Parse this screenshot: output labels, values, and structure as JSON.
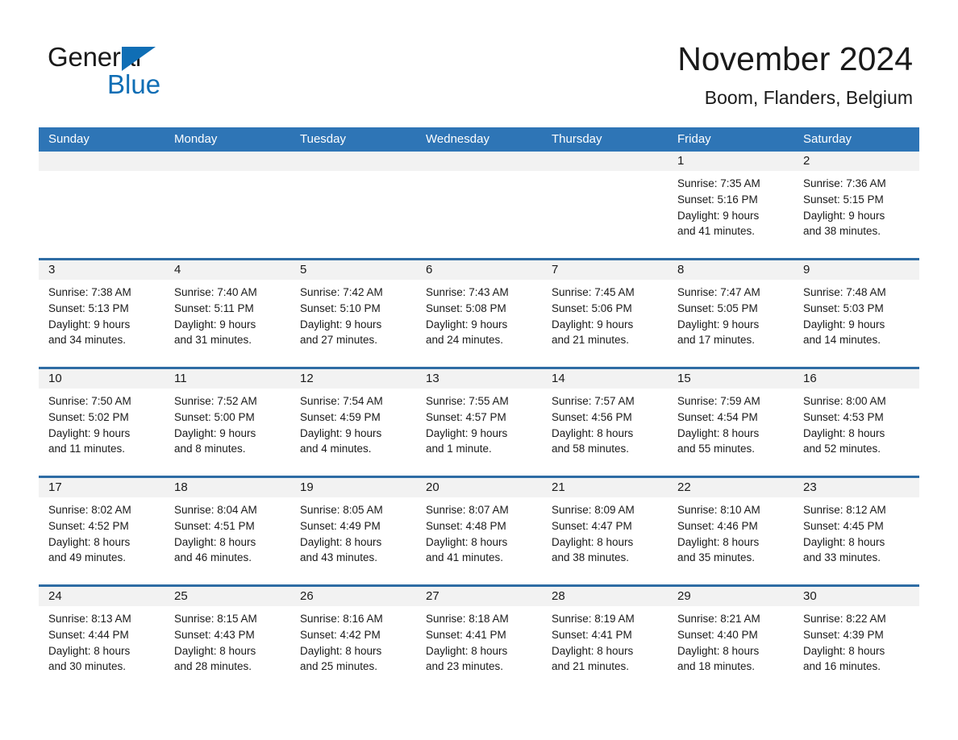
{
  "brand": {
    "name_part1": "General",
    "name_part2": "Blue",
    "triangle_color": "#0f6eb5",
    "text_color": "#1a1a1a"
  },
  "header": {
    "title": "November 2024",
    "subtitle": "Boom, Flanders, Belgium"
  },
  "theme": {
    "header_blue": "#2e75b6",
    "row_divider_blue": "#2e6ca4",
    "day_band_gray": "#f2f2f2",
    "page_background": "#ffffff",
    "text": "#1a1a1a"
  },
  "weekday_headers": [
    "Sunday",
    "Monday",
    "Tuesday",
    "Wednesday",
    "Thursday",
    "Friday",
    "Saturday"
  ],
  "weeks": [
    [
      {
        "day": "",
        "sunrise": "",
        "sunset": "",
        "daylight_line1": "",
        "daylight_line2": ""
      },
      {
        "day": "",
        "sunrise": "",
        "sunset": "",
        "daylight_line1": "",
        "daylight_line2": ""
      },
      {
        "day": "",
        "sunrise": "",
        "sunset": "",
        "daylight_line1": "",
        "daylight_line2": ""
      },
      {
        "day": "",
        "sunrise": "",
        "sunset": "",
        "daylight_line1": "",
        "daylight_line2": ""
      },
      {
        "day": "",
        "sunrise": "",
        "sunset": "",
        "daylight_line1": "",
        "daylight_line2": ""
      },
      {
        "day": "1",
        "sunrise": "Sunrise: 7:35 AM",
        "sunset": "Sunset: 5:16 PM",
        "daylight_line1": "Daylight: 9 hours",
        "daylight_line2": "and 41 minutes."
      },
      {
        "day": "2",
        "sunrise": "Sunrise: 7:36 AM",
        "sunset": "Sunset: 5:15 PM",
        "daylight_line1": "Daylight: 9 hours",
        "daylight_line2": "and 38 minutes."
      }
    ],
    [
      {
        "day": "3",
        "sunrise": "Sunrise: 7:38 AM",
        "sunset": "Sunset: 5:13 PM",
        "daylight_line1": "Daylight: 9 hours",
        "daylight_line2": "and 34 minutes."
      },
      {
        "day": "4",
        "sunrise": "Sunrise: 7:40 AM",
        "sunset": "Sunset: 5:11 PM",
        "daylight_line1": "Daylight: 9 hours",
        "daylight_line2": "and 31 minutes."
      },
      {
        "day": "5",
        "sunrise": "Sunrise: 7:42 AM",
        "sunset": "Sunset: 5:10 PM",
        "daylight_line1": "Daylight: 9 hours",
        "daylight_line2": "and 27 minutes."
      },
      {
        "day": "6",
        "sunrise": "Sunrise: 7:43 AM",
        "sunset": "Sunset: 5:08 PM",
        "daylight_line1": "Daylight: 9 hours",
        "daylight_line2": "and 24 minutes."
      },
      {
        "day": "7",
        "sunrise": "Sunrise: 7:45 AM",
        "sunset": "Sunset: 5:06 PM",
        "daylight_line1": "Daylight: 9 hours",
        "daylight_line2": "and 21 minutes."
      },
      {
        "day": "8",
        "sunrise": "Sunrise: 7:47 AM",
        "sunset": "Sunset: 5:05 PM",
        "daylight_line1": "Daylight: 9 hours",
        "daylight_line2": "and 17 minutes."
      },
      {
        "day": "9",
        "sunrise": "Sunrise: 7:48 AM",
        "sunset": "Sunset: 5:03 PM",
        "daylight_line1": "Daylight: 9 hours",
        "daylight_line2": "and 14 minutes."
      }
    ],
    [
      {
        "day": "10",
        "sunrise": "Sunrise: 7:50 AM",
        "sunset": "Sunset: 5:02 PM",
        "daylight_line1": "Daylight: 9 hours",
        "daylight_line2": "and 11 minutes."
      },
      {
        "day": "11",
        "sunrise": "Sunrise: 7:52 AM",
        "sunset": "Sunset: 5:00 PM",
        "daylight_line1": "Daylight: 9 hours",
        "daylight_line2": "and 8 minutes."
      },
      {
        "day": "12",
        "sunrise": "Sunrise: 7:54 AM",
        "sunset": "Sunset: 4:59 PM",
        "daylight_line1": "Daylight: 9 hours",
        "daylight_line2": "and 4 minutes."
      },
      {
        "day": "13",
        "sunrise": "Sunrise: 7:55 AM",
        "sunset": "Sunset: 4:57 PM",
        "daylight_line1": "Daylight: 9 hours",
        "daylight_line2": "and 1 minute."
      },
      {
        "day": "14",
        "sunrise": "Sunrise: 7:57 AM",
        "sunset": "Sunset: 4:56 PM",
        "daylight_line1": "Daylight: 8 hours",
        "daylight_line2": "and 58 minutes."
      },
      {
        "day": "15",
        "sunrise": "Sunrise: 7:59 AM",
        "sunset": "Sunset: 4:54 PM",
        "daylight_line1": "Daylight: 8 hours",
        "daylight_line2": "and 55 minutes."
      },
      {
        "day": "16",
        "sunrise": "Sunrise: 8:00 AM",
        "sunset": "Sunset: 4:53 PM",
        "daylight_line1": "Daylight: 8 hours",
        "daylight_line2": "and 52 minutes."
      }
    ],
    [
      {
        "day": "17",
        "sunrise": "Sunrise: 8:02 AM",
        "sunset": "Sunset: 4:52 PM",
        "daylight_line1": "Daylight: 8 hours",
        "daylight_line2": "and 49 minutes."
      },
      {
        "day": "18",
        "sunrise": "Sunrise: 8:04 AM",
        "sunset": "Sunset: 4:51 PM",
        "daylight_line1": "Daylight: 8 hours",
        "daylight_line2": "and 46 minutes."
      },
      {
        "day": "19",
        "sunrise": "Sunrise: 8:05 AM",
        "sunset": "Sunset: 4:49 PM",
        "daylight_line1": "Daylight: 8 hours",
        "daylight_line2": "and 43 minutes."
      },
      {
        "day": "20",
        "sunrise": "Sunrise: 8:07 AM",
        "sunset": "Sunset: 4:48 PM",
        "daylight_line1": "Daylight: 8 hours",
        "daylight_line2": "and 41 minutes."
      },
      {
        "day": "21",
        "sunrise": "Sunrise: 8:09 AM",
        "sunset": "Sunset: 4:47 PM",
        "daylight_line1": "Daylight: 8 hours",
        "daylight_line2": "and 38 minutes."
      },
      {
        "day": "22",
        "sunrise": "Sunrise: 8:10 AM",
        "sunset": "Sunset: 4:46 PM",
        "daylight_line1": "Daylight: 8 hours",
        "daylight_line2": "and 35 minutes."
      },
      {
        "day": "23",
        "sunrise": "Sunrise: 8:12 AM",
        "sunset": "Sunset: 4:45 PM",
        "daylight_line1": "Daylight: 8 hours",
        "daylight_line2": "and 33 minutes."
      }
    ],
    [
      {
        "day": "24",
        "sunrise": "Sunrise: 8:13 AM",
        "sunset": "Sunset: 4:44 PM",
        "daylight_line1": "Daylight: 8 hours",
        "daylight_line2": "and 30 minutes."
      },
      {
        "day": "25",
        "sunrise": "Sunrise: 8:15 AM",
        "sunset": "Sunset: 4:43 PM",
        "daylight_line1": "Daylight: 8 hours",
        "daylight_line2": "and 28 minutes."
      },
      {
        "day": "26",
        "sunrise": "Sunrise: 8:16 AM",
        "sunset": "Sunset: 4:42 PM",
        "daylight_line1": "Daylight: 8 hours",
        "daylight_line2": "and 25 minutes."
      },
      {
        "day": "27",
        "sunrise": "Sunrise: 8:18 AM",
        "sunset": "Sunset: 4:41 PM",
        "daylight_line1": "Daylight: 8 hours",
        "daylight_line2": "and 23 minutes."
      },
      {
        "day": "28",
        "sunrise": "Sunrise: 8:19 AM",
        "sunset": "Sunset: 4:41 PM",
        "daylight_line1": "Daylight: 8 hours",
        "daylight_line2": "and 21 minutes."
      },
      {
        "day": "29",
        "sunrise": "Sunrise: 8:21 AM",
        "sunset": "Sunset: 4:40 PM",
        "daylight_line1": "Daylight: 8 hours",
        "daylight_line2": "and 18 minutes."
      },
      {
        "day": "30",
        "sunrise": "Sunrise: 8:22 AM",
        "sunset": "Sunset: 4:39 PM",
        "daylight_line1": "Daylight: 8 hours",
        "daylight_line2": "and 16 minutes."
      }
    ]
  ]
}
